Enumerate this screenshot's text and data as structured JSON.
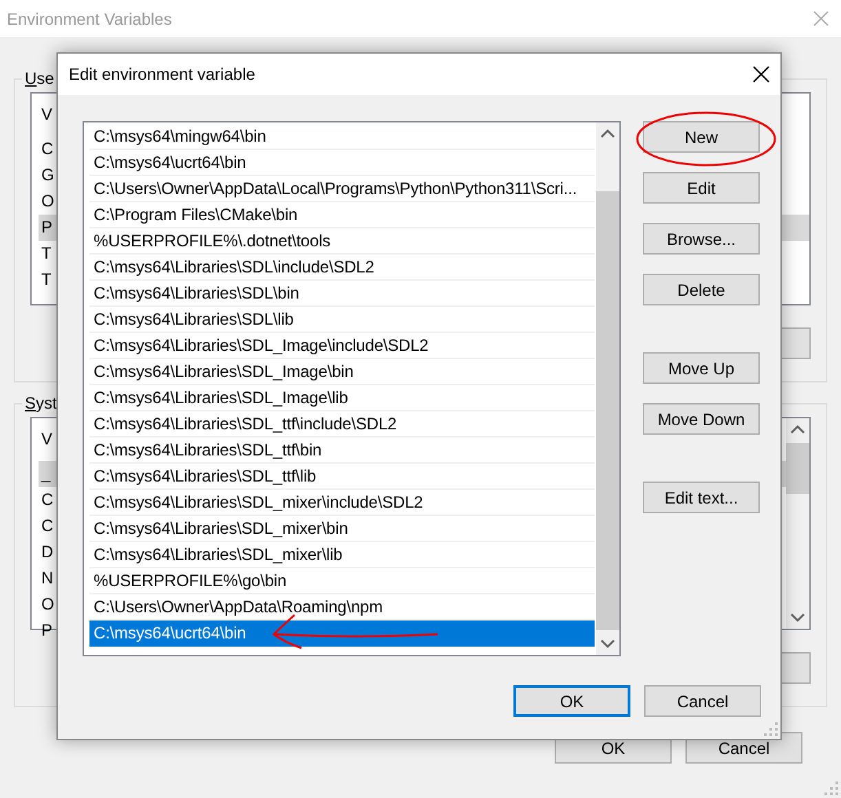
{
  "window": {
    "title": "Environment Variables"
  },
  "user_variables": {
    "label": "Use",
    "header": "V",
    "rows": [
      {
        "name": "C",
        "selected": false
      },
      {
        "name": "G",
        "selected": false
      },
      {
        "name": "O",
        "selected": false
      },
      {
        "name": "P",
        "selected": true
      },
      {
        "name": "T",
        "selected": false
      },
      {
        "name": "T",
        "selected": false
      }
    ]
  },
  "system_variables": {
    "label": "Syst",
    "header": "V",
    "rows": [
      {
        "name": "_",
        "selected": true
      },
      {
        "name": "C",
        "selected": false
      },
      {
        "name": "C",
        "selected": false
      },
      {
        "name": "D",
        "selected": false
      },
      {
        "name": "N",
        "selected": false
      },
      {
        "name": "O",
        "selected": false
      },
      {
        "name": "P",
        "selected": false
      }
    ]
  },
  "buttons": [
    {
      "label": "OK",
      "default": false
    },
    {
      "label": "Cancel",
      "default": false
    }
  ],
  "dialog": {
    "title": "Edit environment variable",
    "entries": [
      {
        "value": "C:\\msys64\\mingw64\\bin",
        "selected": false
      },
      {
        "value": "C:\\msys64\\ucrt64\\bin",
        "selected": false
      },
      {
        "value": "C:\\Users\\Owner\\AppData\\Local\\Programs\\Python\\Python311\\Scri...",
        "selected": false
      },
      {
        "value": "C:\\Program Files\\CMake\\bin",
        "selected": false
      },
      {
        "value": "%USERPROFILE%\\.dotnet\\tools",
        "selected": false
      },
      {
        "value": "C:\\msys64\\Libraries\\SDL\\include\\SDL2",
        "selected": false
      },
      {
        "value": "C:\\msys64\\Libraries\\SDL\\bin",
        "selected": false
      },
      {
        "value": "C:\\msys64\\Libraries\\SDL\\lib",
        "selected": false
      },
      {
        "value": "C:\\msys64\\Libraries\\SDL_Image\\include\\SDL2",
        "selected": false
      },
      {
        "value": "C:\\msys64\\Libraries\\SDL_Image\\bin",
        "selected": false
      },
      {
        "value": "C:\\msys64\\Libraries\\SDL_Image\\lib",
        "selected": false
      },
      {
        "value": "C:\\msys64\\Libraries\\SDL_ttf\\include\\SDL2",
        "selected": false
      },
      {
        "value": "C:\\msys64\\Libraries\\SDL_ttf\\bin",
        "selected": false
      },
      {
        "value": "C:\\msys64\\Libraries\\SDL_ttf\\lib",
        "selected": false
      },
      {
        "value": "C:\\msys64\\Libraries\\SDL_mixer\\include\\SDL2",
        "selected": false
      },
      {
        "value": "C:\\msys64\\Libraries\\SDL_mixer\\bin",
        "selected": false
      },
      {
        "value": "C:\\msys64\\Libraries\\SDL_mixer\\lib",
        "selected": false
      },
      {
        "value": "%USERPROFILE%\\go\\bin",
        "selected": false
      },
      {
        "value": "C:\\Users\\Owner\\AppData\\Roaming\\npm",
        "selected": false
      },
      {
        "value": "C:\\msys64\\ucrt64\\bin",
        "selected": true
      }
    ],
    "side_buttons": [
      [
        "New",
        "Edit",
        "Browse...",
        "Delete"
      ],
      [
        "Move Up",
        "Move Down"
      ],
      [
        "Edit text..."
      ]
    ],
    "buttons": [
      {
        "label": "OK",
        "default": true
      },
      {
        "label": "Cancel",
        "default": false
      }
    ]
  }
}
